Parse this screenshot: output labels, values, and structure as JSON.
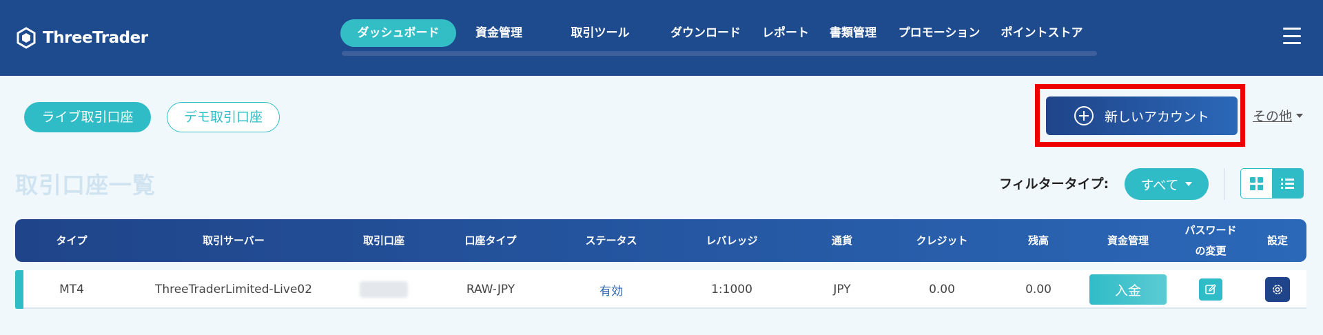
{
  "header": {
    "logo_text": "ThreeTrader",
    "nav": [
      {
        "label": "ダッシュボード",
        "active": true
      },
      {
        "label": "資金管理"
      },
      {
        "label": "取引ツール"
      },
      {
        "label": "ダウンロード"
      },
      {
        "label": "レポート"
      },
      {
        "label": "書類管理"
      },
      {
        "label": "プロモーション"
      },
      {
        "label": "ポイントストア"
      }
    ]
  },
  "tabs": {
    "live": "ライブ取引口座",
    "demo": "デモ取引口座"
  },
  "actions": {
    "new_account": "新しいアカウント",
    "other": "その他"
  },
  "page_title": "取引口座一覧",
  "filter": {
    "label": "フィルタータイプ:",
    "selected": "すべて",
    "view_mode": "list"
  },
  "table": {
    "columns": [
      "タイプ",
      "取引サーバー",
      "取引口座",
      "口座タイプ",
      "ステータス",
      "レバレッジ",
      "通貨",
      "クレジット",
      "残高",
      "資金管理",
      "パスワード",
      "の変更",
      "設定"
    ],
    "rows": [
      {
        "type": "MT4",
        "server": "ThreeTraderLimited-Live02",
        "account": "",
        "account_type": "RAW-JPY",
        "status": "有効",
        "leverage": "1:1000",
        "currency": "JPY",
        "credit": "0.00",
        "balance": "0.00",
        "deposit_label": "入金"
      }
    ]
  },
  "colors": {
    "header_bg": "#1e4a8e",
    "accent_teal": "#2fbcc7",
    "primary_blue": "#1f4489",
    "highlight_red": "#ee0000"
  }
}
